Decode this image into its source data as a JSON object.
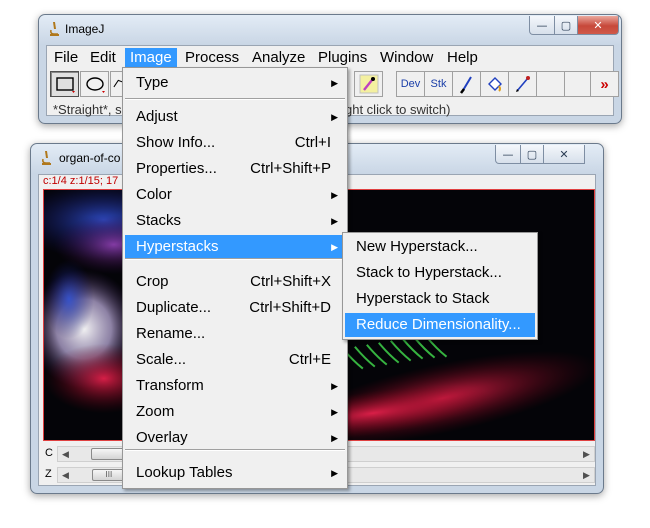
{
  "main_window": {
    "title": "ImageJ",
    "controls": {
      "minimize": "—",
      "maximize": "▢",
      "close": "✕"
    },
    "menubar": [
      "File",
      "Edit",
      "Image",
      "Process",
      "Analyze",
      "Plugins",
      "Window",
      "Help"
    ],
    "active_menu": "Image",
    "toolbar": {
      "dev_label": "Dev",
      "stk_label": "Stk",
      "more_label": "»"
    },
    "status_left": "*Straight*, se",
    "status_right": "ght click to switch)"
  },
  "image_window": {
    "title": "organ-of-co",
    "info": "c:1/4 z:1/15; 17",
    "sliders": [
      {
        "label": "C",
        "position": 0.04
      },
      {
        "label": "Z",
        "position": 0.04,
        "thumb_text": "III"
      }
    ]
  },
  "image_menu": {
    "groups": [
      [
        {
          "label": "Type",
          "submenu": true
        }
      ],
      [
        {
          "label": "Adjust",
          "submenu": true
        },
        {
          "label": "Show Info...",
          "accel": "Ctrl+I"
        },
        {
          "label": "Properties...",
          "accel": "Ctrl+Shift+P"
        },
        {
          "label": "Color",
          "submenu": true
        },
        {
          "label": "Stacks",
          "submenu": true
        },
        {
          "label": "Hyperstacks",
          "submenu": true,
          "highlighted": true
        }
      ],
      [
        {
          "label": "Crop",
          "accel": "Ctrl+Shift+X"
        },
        {
          "label": "Duplicate...",
          "accel": "Ctrl+Shift+D"
        },
        {
          "label": "Rename..."
        },
        {
          "label": "Scale...",
          "accel": "Ctrl+E"
        },
        {
          "label": "Transform",
          "submenu": true
        },
        {
          "label": "Zoom",
          "submenu": true
        },
        {
          "label": "Overlay",
          "submenu": true
        }
      ],
      [
        {
          "label": "Lookup Tables",
          "submenu": true
        }
      ]
    ],
    "submenu_arrow": "▶"
  },
  "hyperstacks_menu": {
    "items": [
      {
        "label": "New Hyperstack..."
      },
      {
        "label": "Stack to Hyperstack..."
      },
      {
        "label": "Hyperstack to Stack"
      },
      {
        "label": "Reduce Dimensionality...",
        "highlighted": true
      }
    ]
  },
  "colors": {
    "highlight": "#3399ff",
    "info_text": "#c00000",
    "more_tools": "#cc0000"
  }
}
